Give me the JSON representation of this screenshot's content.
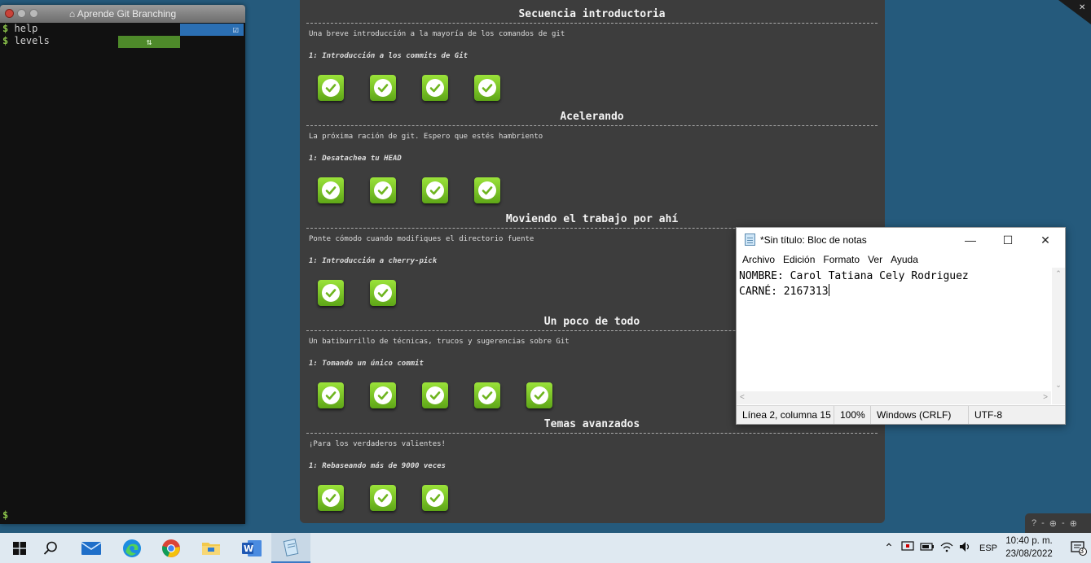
{
  "terminal": {
    "title": "Aprende Git Branching",
    "prompt": "$",
    "lines": [
      "help",
      "levels"
    ],
    "level_icon": "⇅"
  },
  "levels": [
    {
      "title": "Secuencia introductoria",
      "description": "Una breve introducción a la mayoría de los comandos de git",
      "subtitle": "1: Introducción a los commits de Git",
      "completed": 4
    },
    {
      "title": "Acelerando",
      "description": "La próxima ración de git. Espero que estés hambriento",
      "subtitle": "1: Desatachea tu HEAD",
      "completed": 4
    },
    {
      "title": "Moviendo el trabajo por ahí",
      "description": "Ponte cómodo cuando modifiques el directorio fuente",
      "subtitle": "1: Introducción a cherry-pick",
      "completed": 2
    },
    {
      "title": "Un poco de todo",
      "description": "Un batiburrillo de técnicas, trucos y sugerencias sobre Git",
      "subtitle": "1: Tomando un único commit",
      "completed": 5
    },
    {
      "title": "Temas avanzados",
      "description": "¡Para los verdaderos valientes!",
      "subtitle": "1: Rebaseando más de 9000 veces",
      "completed": 3
    }
  ],
  "notepad": {
    "title": "*Sin título: Bloc de notas",
    "controls": {
      "minimize": "—",
      "maximize": "☐",
      "close": "✕"
    },
    "menu": [
      "Archivo",
      "Edición",
      "Formato",
      "Ver",
      "Ayuda"
    ],
    "line1": "NOMBRE: Carol Tatiana Cely Rodriguez",
    "line2": "CARNÉ: 2167313",
    "status": {
      "position": "Línea 2, columna 15",
      "zoom": "100%",
      "eol": "Windows (CRLF)",
      "encoding": "UTF-8"
    }
  },
  "mini_bar": {
    "items": [
      "?",
      "-",
      "⊕",
      "-",
      "⊕"
    ]
  },
  "taskbar": {
    "apps": [
      "start-icon",
      "search-icon",
      "mail-icon",
      "edge-icon",
      "chrome-icon",
      "file-explorer-icon",
      "word-icon",
      "notepad-icon"
    ],
    "tray_lang": "ESP",
    "time": "10:40 p. m.",
    "date": "23/08/2022",
    "notification_count": "3"
  }
}
